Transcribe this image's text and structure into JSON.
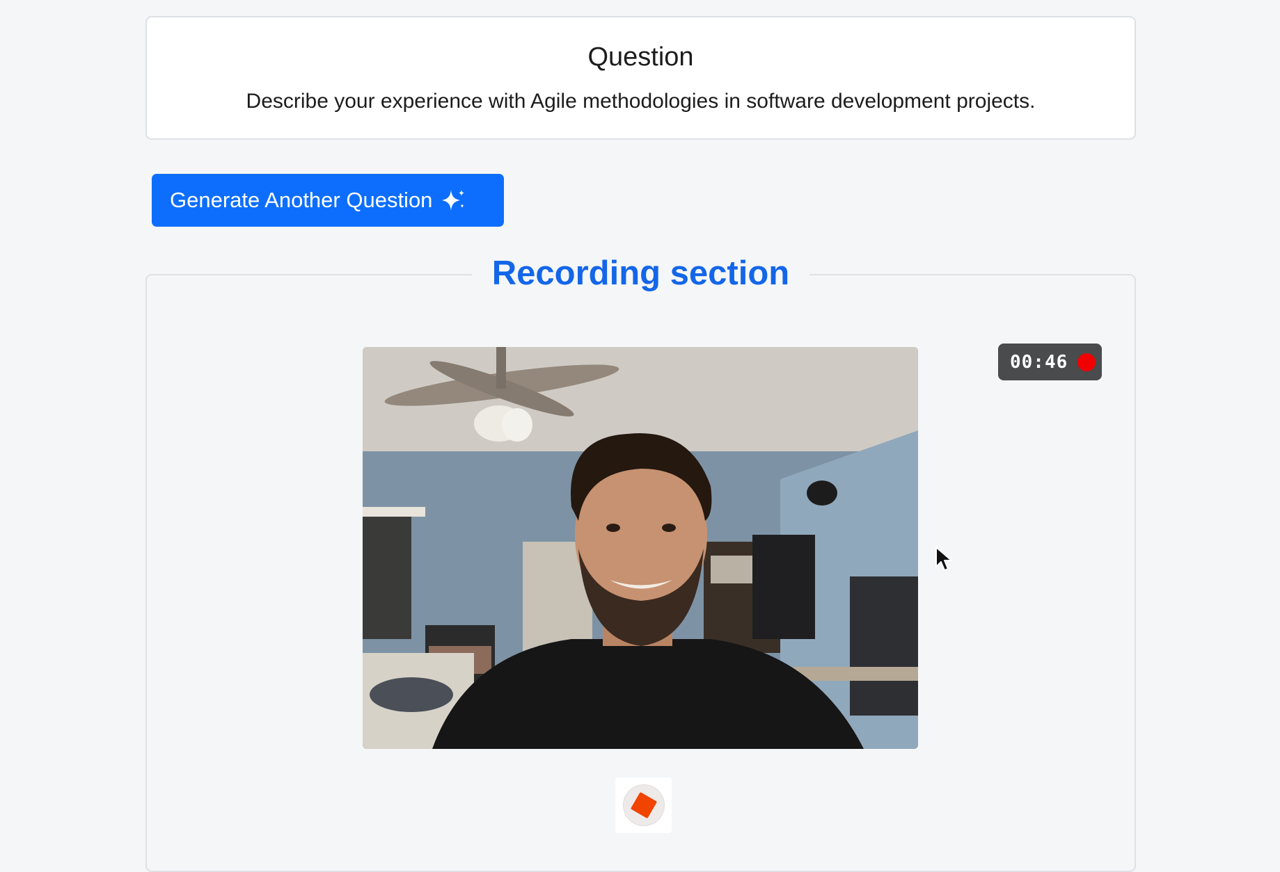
{
  "question": {
    "title": "Question",
    "text": "Describe your experience with Agile methodologies in software development projects."
  },
  "actions": {
    "generate_label": "Generate Another Question",
    "generate_icon": "sparkles-icon"
  },
  "recording": {
    "legend": "Recording section",
    "timer": "00:46",
    "timer_icon": "record-dot-icon",
    "stop_icon": "stop-icon"
  },
  "colors": {
    "primary": "#0d6efd",
    "legend": "#1466e8",
    "record": "#f00000",
    "stop": "#f04400",
    "background": "#f4f6f8"
  }
}
